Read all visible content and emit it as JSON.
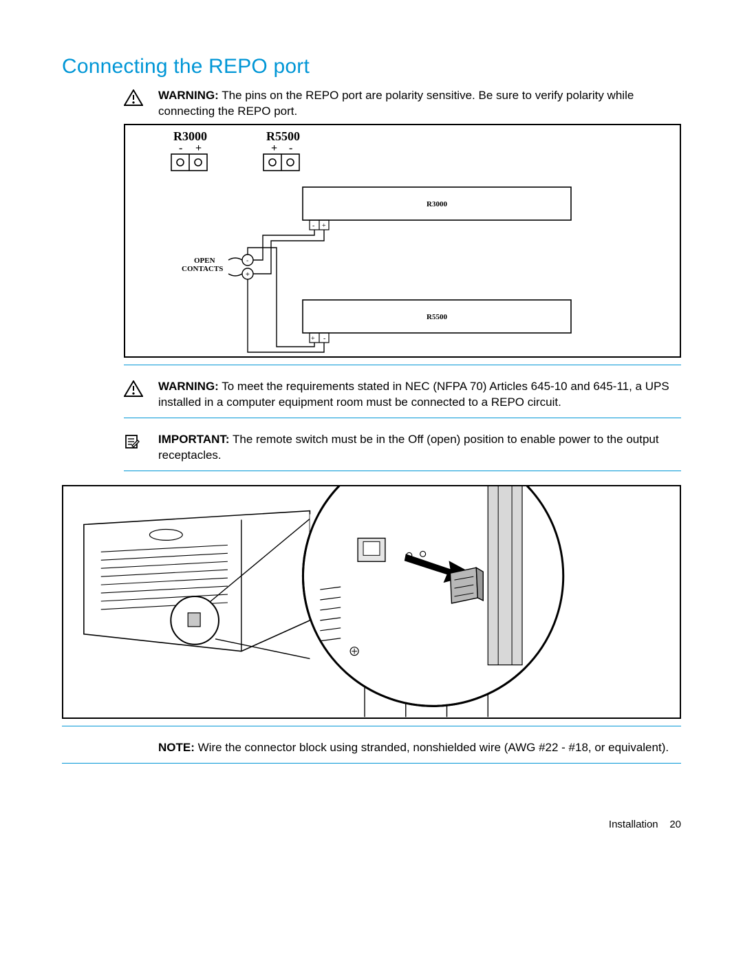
{
  "title": "Connecting the REPO port",
  "warning1": {
    "lead": "WARNING:",
    "body": "The pins on the REPO port are polarity sensitive. Be sure to verify polarity while connecting the REPO port."
  },
  "diagram1": {
    "heading_a": "R3000",
    "heading_b": "R5500",
    "minus": "-",
    "plus": "+",
    "open": "OPEN",
    "contacts": "CONTACTS",
    "box_a_label": "R3000",
    "box_b_label": "R5500"
  },
  "warning2": {
    "lead": "WARNING:",
    "body": "To meet the requirements stated in NEC (NFPA 70) Articles 645-10 and 645-11, a UPS installed in a computer equipment room must be connected to a REPO circuit."
  },
  "important": {
    "lead": "IMPORTANT:",
    "body": "The remote switch must be in the Off (open) position to enable power to the output receptacles."
  },
  "note": {
    "lead": "NOTE:",
    "body": "Wire the connector block using stranded, nonshielded wire (AWG #22 - #18, or equivalent)."
  },
  "footer": {
    "section": "Installation",
    "page": "20"
  }
}
